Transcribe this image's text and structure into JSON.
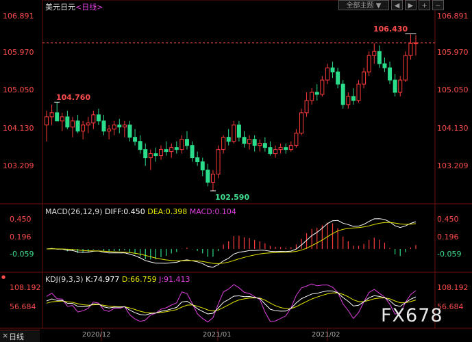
{
  "header": {
    "symbol": "美元日元",
    "period": "<日线>",
    "theme_label": "全部主题",
    "theme_arrow": "▼",
    "nav_left": "◀",
    "nav_right": "▶",
    "zoom_in": "+",
    "zoom_out": "−"
  },
  "price_axis": {
    "labels": [
      "106.891",
      "105.970",
      "105.050",
      "104.130",
      "103.209"
    ],
    "ticks": [
      106.891,
      105.97,
      105.05,
      104.13,
      103.209
    ]
  },
  "annotations": {
    "high": "106.430",
    "mid_high": "104.760",
    "low": "102.590",
    "last_price": 106.21
  },
  "macd": {
    "title": "MACD(26,12,9)",
    "diff": "DIFF:0.450",
    "dea": "DEA:0.398",
    "macd": "MACD:0.104",
    "labels": [
      "0.450",
      "0.196",
      "-0.059"
    ]
  },
  "kdj": {
    "title": "KDJ(9,3,3)",
    "k": "K:74.977",
    "d": "D:66.759",
    "j": "J:91.413",
    "labels": [
      "108.192",
      "56.684"
    ]
  },
  "xaxis": {
    "labels": [
      "2020/12",
      "2021/01",
      "2021/02"
    ]
  },
  "footer": {
    "period_tab": "日线",
    "marker_icon": "●"
  },
  "watermark": "FX678",
  "colors": {
    "up": "#ff3b3b",
    "down": "#2bdc8b",
    "grid": "#6b0f0f",
    "text_red": "#ff4c4c",
    "text_green": "#3fe08f",
    "diff_line": "#ffffff",
    "dea_line": "#e6e600",
    "macd_color": "#e040e0",
    "k_line": "#ffffff",
    "d_line": "#e6e600",
    "j_line": "#e040e0"
  },
  "chart_data": {
    "type": "candlestick",
    "series": [
      {
        "name": "price",
        "ohlc": [
          [
            104.2,
            104.55,
            103.8,
            104.4
          ],
          [
            104.4,
            104.7,
            104.2,
            104.5
          ],
          [
            104.5,
            104.76,
            104.3,
            104.3
          ],
          [
            104.3,
            104.5,
            104.05,
            104.4
          ],
          [
            104.4,
            104.55,
            104.1,
            104.15
          ],
          [
            104.15,
            104.4,
            103.9,
            104.3
          ],
          [
            104.3,
            104.45,
            104.0,
            104.05
          ],
          [
            104.05,
            104.3,
            103.85,
            104.2
          ],
          [
            104.2,
            104.4,
            104.0,
            104.25
          ],
          [
            104.25,
            104.55,
            104.1,
            104.45
          ],
          [
            104.45,
            104.6,
            104.2,
            104.3
          ],
          [
            104.3,
            104.45,
            103.95,
            104.05
          ],
          [
            104.05,
            104.2,
            103.85,
            104.1
          ],
          [
            104.1,
            104.3,
            103.95,
            104.2
          ],
          [
            104.2,
            104.35,
            104.0,
            104.15
          ],
          [
            104.15,
            104.3,
            103.9,
            104.2
          ],
          [
            104.2,
            104.3,
            103.8,
            103.9
          ],
          [
            103.9,
            104.1,
            103.7,
            103.8
          ],
          [
            103.8,
            103.95,
            103.5,
            103.6
          ],
          [
            103.6,
            103.75,
            103.2,
            103.4
          ],
          [
            103.4,
            103.6,
            103.1,
            103.5
          ],
          [
            103.5,
            103.65,
            103.3,
            103.45
          ],
          [
            103.45,
            103.7,
            103.35,
            103.6
          ],
          [
            103.6,
            103.8,
            103.45,
            103.55
          ],
          [
            103.55,
            103.75,
            103.4,
            103.65
          ],
          [
            103.65,
            103.8,
            103.5,
            103.6
          ],
          [
            103.6,
            103.95,
            103.5,
            103.85
          ],
          [
            103.85,
            104.05,
            103.6,
            103.7
          ],
          [
            103.7,
            103.8,
            103.3,
            103.4
          ],
          [
            103.4,
            103.55,
            103.2,
            103.3
          ],
          [
            103.3,
            103.4,
            102.95,
            103.1
          ],
          [
            103.1,
            103.25,
            102.7,
            102.8
          ],
          [
            102.8,
            103.1,
            102.59,
            103.0
          ],
          [
            103.0,
            103.7,
            102.9,
            103.6
          ],
          [
            103.6,
            103.95,
            103.5,
            103.9
          ],
          [
            103.9,
            104.1,
            103.7,
            103.8
          ],
          [
            103.8,
            104.3,
            103.75,
            104.2
          ],
          [
            104.2,
            104.3,
            103.8,
            103.9
          ],
          [
            103.9,
            104.05,
            103.65,
            103.75
          ],
          [
            103.75,
            103.95,
            103.6,
            103.85
          ],
          [
            103.85,
            103.95,
            103.55,
            103.7
          ],
          [
            103.7,
            103.85,
            103.55,
            103.75
          ],
          [
            103.75,
            103.9,
            103.55,
            103.65
          ],
          [
            103.65,
            103.8,
            103.45,
            103.5
          ],
          [
            103.5,
            103.7,
            103.4,
            103.6
          ],
          [
            103.6,
            103.75,
            103.5,
            103.65
          ],
          [
            103.65,
            103.75,
            103.5,
            103.6
          ],
          [
            103.6,
            103.8,
            103.55,
            103.7
          ],
          [
            103.7,
            104.1,
            103.65,
            104.0
          ],
          [
            104.0,
            104.6,
            103.95,
            104.5
          ],
          [
            104.5,
            105.0,
            104.4,
            104.8
          ],
          [
            104.8,
            105.1,
            104.7,
            105.0
          ],
          [
            105.0,
            105.2,
            104.8,
            104.95
          ],
          [
            104.95,
            105.4,
            104.9,
            105.3
          ],
          [
            105.3,
            105.7,
            105.2,
            105.6
          ],
          [
            105.6,
            105.75,
            105.35,
            105.5
          ],
          [
            105.5,
            105.6,
            105.1,
            105.2
          ],
          [
            105.2,
            105.3,
            104.6,
            104.7
          ],
          [
            104.7,
            105.0,
            104.6,
            104.9
          ],
          [
            104.9,
            105.1,
            104.7,
            104.8
          ],
          [
            104.8,
            105.3,
            104.75,
            105.2
          ],
          [
            105.2,
            105.6,
            105.1,
            105.5
          ],
          [
            105.5,
            106.0,
            105.4,
            105.9
          ],
          [
            105.9,
            106.2,
            105.7,
            106.0
          ],
          [
            106.0,
            106.15,
            105.6,
            105.7
          ],
          [
            105.7,
            105.85,
            105.5,
            105.6
          ],
          [
            105.6,
            105.75,
            105.2,
            105.3
          ],
          [
            105.3,
            105.45,
            104.9,
            105.0
          ],
          [
            105.0,
            105.4,
            104.9,
            105.3
          ],
          [
            105.3,
            106.0,
            105.25,
            105.9
          ],
          [
            105.9,
            106.43,
            105.8,
            106.2
          ],
          [
            106.2,
            106.4,
            105.9,
            106.21
          ]
        ]
      }
    ],
    "macd_diff_points": 72,
    "kdj_points": 72
  }
}
